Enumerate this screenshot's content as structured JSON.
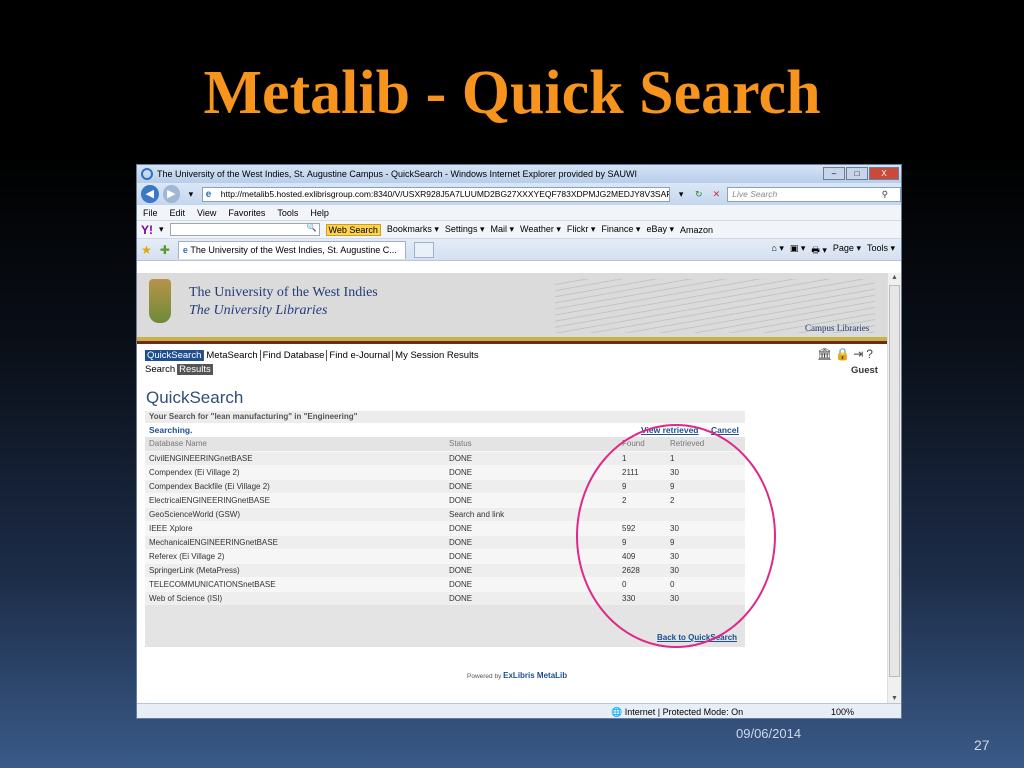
{
  "slide": {
    "title": "Metalib  - Quick Search",
    "date": "09/06/2014",
    "page_number": "27"
  },
  "browser": {
    "title": "The University of the West Indies, St. Augustine Campus - QuickSearch - Windows Internet Explorer provided by SAUWI",
    "window_buttons": [
      "–",
      "□",
      "X"
    ],
    "url": "http://metalib5.hosted.exlibrisgroup.com:8340/V/USXR928J5A7LUUMD2BG27XXXYEQF783XDPMJG2MEDJY8V3SAFI",
    "live_search_placeholder": "Live Search",
    "menu": [
      "File",
      "Edit",
      "View",
      "Favorites",
      "Tools",
      "Help"
    ],
    "yahoo_toolbar": {
      "logo": "Y!",
      "web_search": "Web Search",
      "items": [
        "Bookmarks ▾",
        "Settings ▾",
        "Mail ▾",
        "Weather ▾",
        "Flickr ▾",
        "Finance ▾",
        "eBay ▾",
        "Amazon"
      ]
    },
    "tab_label": "The University of the West Indies, St. Augustine C...",
    "command_bar": [
      "⌂ ▾",
      "▣ ▾",
      "🖶 ▾",
      "Page ▾",
      "Tools ▾"
    ],
    "status": {
      "zone": "Internet | Protected Mode: On",
      "zoom": "100%"
    }
  },
  "page": {
    "university_line1": "The University of the West Indies",
    "university_line2": "The University Libraries",
    "campus_libraries": "Campus Libraries",
    "nav": [
      "QuickSearch",
      "MetaSearch",
      "Find Database",
      "Find e-Journal",
      "My Session Results"
    ],
    "subnav": [
      "Search",
      "Results"
    ],
    "guest": "Guest",
    "heading": "QuickSearch",
    "search_summary": "Your Search for \"lean manufacturing\" in \"Engineering\"",
    "searching": "Searching.",
    "view_retrieved": "View retrieved",
    "cancel": "Cancel",
    "columns": [
      "Database Name",
      "Status",
      "Found",
      "Retrieved"
    ],
    "rows": [
      [
        "CivilENGINEERINGnetBASE",
        "DONE",
        "1",
        "1"
      ],
      [
        "Compendex (Ei Village 2)",
        "DONE",
        "2111",
        "30"
      ],
      [
        "Compendex Backfile (Ei Village 2)",
        "DONE",
        "9",
        "9"
      ],
      [
        "ElectricalENGINEERINGnetBASE",
        "DONE",
        "2",
        "2"
      ],
      [
        "GeoScienceWorld (GSW)",
        "Search and link",
        "",
        ""
      ],
      [
        "IEEE Xplore",
        "DONE",
        "592",
        "30"
      ],
      [
        "MechanicalENGINEERINGnetBASE",
        "DONE",
        "9",
        "9"
      ],
      [
        "Referex (Ei Village 2)",
        "DONE",
        "409",
        "30"
      ],
      [
        "SpringerLink (MetaPress)",
        "DONE",
        "2628",
        "30"
      ],
      [
        "TELECOMMUNICATIONSnetBASE",
        "DONE",
        "0",
        "0"
      ],
      [
        "Web of Science (ISI)",
        "DONE",
        "330",
        "30"
      ]
    ],
    "back_link": "Back to QuickSearch",
    "powered_by": "Powered by",
    "powered_brand": "ExLibris MetaLib"
  },
  "colors": {
    "title_orange": "#f7941d",
    "highlight_ring": "#e0278a",
    "link_blue": "#1d4f91"
  }
}
